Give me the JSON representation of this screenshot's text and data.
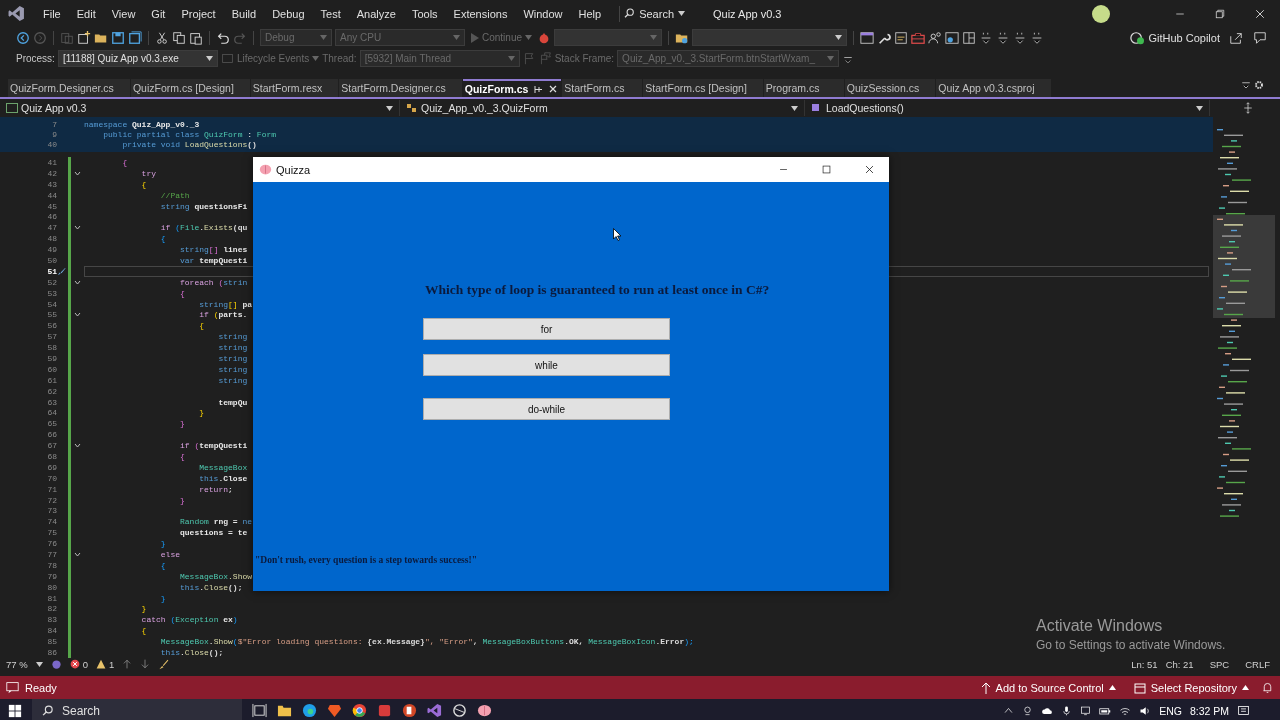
{
  "menu": [
    "File",
    "Edit",
    "View",
    "Git",
    "Project",
    "Build",
    "Debug",
    "Test",
    "Analyze",
    "Tools",
    "Extensions",
    "Window",
    "Help"
  ],
  "search": {
    "label": "Search"
  },
  "window": {
    "title": "Quiz App v0.3"
  },
  "toolbar": {
    "configuration": {
      "value": "Debug",
      "disabled": true
    },
    "platform": {
      "value": "Any CPU",
      "disabled": true
    },
    "continue": {
      "label": "Continue",
      "disabled": true
    },
    "copilot": "GitHub Copilot"
  },
  "debug_bar": {
    "process_label": "Process:",
    "process": {
      "value": "[11188] Quiz App v0.3.exe",
      "disabled": false
    },
    "lifecycle": "Lifecycle Events",
    "thread_label": "Thread:",
    "thread": {
      "value": "[5932] Main Thread",
      "disabled": true
    },
    "frame_label": "Stack Frame:",
    "frame": {
      "value": "Quiz_App_v0._3.StartForm.btnStartWxam_",
      "disabled": true
    }
  },
  "tabs": [
    {
      "label": "QuizForm.Designer.cs",
      "selected": false
    },
    {
      "label": "QuizForm.cs [Design]",
      "selected": false
    },
    {
      "label": "StartForm.resx",
      "selected": false
    },
    {
      "label": "StartForm.Designer.cs",
      "selected": false
    },
    {
      "label": "QuizForm.cs",
      "selected": true
    },
    {
      "label": "StartForm.cs",
      "selected": false
    },
    {
      "label": "StartForm.cs [Design]",
      "selected": false
    },
    {
      "label": "Program.cs",
      "selected": false
    },
    {
      "label": "QuizSession.cs",
      "selected": false
    },
    {
      "label": "Quiz App v0.3.csproj",
      "selected": false
    }
  ],
  "navigation": {
    "project": "Quiz App v0.3",
    "type": "Quiz_App_v0._3.QuizForm",
    "member": "LoadQuestions()"
  },
  "sticky_lines": [
    {
      "no": "7",
      "code": [
        {
          "t": "namespace ",
          "kind": "keyword"
        },
        {
          "t": "Quiz_App_v0._3",
          "kind": "identifier"
        }
      ]
    },
    {
      "no": "9",
      "code": [
        {
          "t": "    public partial class ",
          "kind": "keyword"
        },
        {
          "t": "QuizForm",
          "kind": "type"
        },
        {
          "t": " : ",
          "kind": "plain"
        },
        {
          "t": "Form",
          "kind": "type"
        }
      ]
    },
    {
      "no": "40",
      "code": [
        {
          "t": "        private void ",
          "kind": "keyword"
        },
        {
          "t": "LoadQuestions",
          "kind": "method"
        },
        {
          "t": "()",
          "kind": "plain"
        }
      ]
    }
  ],
  "lines": [
    {
      "no": "41",
      "fold": false,
      "current": false,
      "code": [
        {
          "t": "        {",
          "kind": "brace1"
        }
      ]
    },
    {
      "no": "42",
      "fold": true,
      "current": false,
      "code": [
        {
          "t": "            try",
          "kind": "control"
        }
      ]
    },
    {
      "no": "43",
      "fold": false,
      "current": false,
      "code": [
        {
          "t": "            {",
          "kind": "brace2"
        }
      ]
    },
    {
      "no": "44",
      "fold": false,
      "current": false,
      "code": [
        {
          "t": "                //Path",
          "kind": "comment"
        }
      ]
    },
    {
      "no": "45",
      "fold": false,
      "current": false,
      "code": [
        {
          "t": "                string ",
          "kind": "keyword"
        },
        {
          "t": "questionsFi",
          "kind": "identifier"
        }
      ]
    },
    {
      "no": "46",
      "fold": false,
      "current": false
    },
    {
      "no": "47",
      "fold": true,
      "current": false,
      "code": [
        {
          "t": "                if ",
          "kind": "control"
        },
        {
          "t": "(",
          "kind": "brace3"
        },
        {
          "t": "File",
          "kind": "type"
        },
        {
          "t": ".",
          "kind": "plain"
        },
        {
          "t": "Exists",
          "kind": "method"
        },
        {
          "t": "(qu",
          "kind": "plain"
        }
      ]
    },
    {
      "no": "48",
      "fold": false,
      "current": false,
      "code": [
        {
          "t": "                {",
          "kind": "brace3"
        }
      ]
    },
    {
      "no": "49",
      "fold": false,
      "current": false,
      "code": [
        {
          "t": "                    string",
          "kind": "keyword"
        },
        {
          "t": "[] ",
          "kind": "brace1"
        },
        {
          "t": "lines",
          "kind": "identifier"
        }
      ]
    },
    {
      "no": "50",
      "fold": false,
      "current": false,
      "code": [
        {
          "t": "                    var ",
          "kind": "keyword"
        },
        {
          "t": "tempQuesti",
          "kind": "identifier"
        }
      ]
    },
    {
      "no": "51",
      "fold": false,
      "current": true
    },
    {
      "no": "52",
      "fold": true,
      "current": false,
      "code": [
        {
          "t": "                    foreach ",
          "kind": "control"
        },
        {
          "t": "(",
          "kind": "brace1"
        },
        {
          "t": "strin",
          "kind": "keyword"
        }
      ]
    },
    {
      "no": "53",
      "fold": false,
      "current": false,
      "code": [
        {
          "t": "                    {",
          "kind": "brace1"
        }
      ]
    },
    {
      "no": "54",
      "fold": false,
      "current": false,
      "code": [
        {
          "t": "                        string",
          "kind": "keyword"
        },
        {
          "t": "[] ",
          "kind": "brace2"
        },
        {
          "t": "pa",
          "kind": "identifier"
        }
      ]
    },
    {
      "no": "55",
      "fold": true,
      "current": false,
      "code": [
        {
          "t": "                        if ",
          "kind": "control"
        },
        {
          "t": "(",
          "kind": "brace2"
        },
        {
          "t": "parts.",
          "kind": "identifier"
        }
      ]
    },
    {
      "no": "56",
      "fold": false,
      "current": false,
      "code": [
        {
          "t": "                        {",
          "kind": "brace2"
        }
      ]
    },
    {
      "no": "57",
      "fold": false,
      "current": false,
      "code": [
        {
          "t": "                            string",
          "kind": "keyword"
        }
      ]
    },
    {
      "no": "58",
      "fold": false,
      "current": false,
      "code": [
        {
          "t": "                            string",
          "kind": "keyword"
        }
      ]
    },
    {
      "no": "59",
      "fold": false,
      "current": false,
      "code": [
        {
          "t": "                            string",
          "kind": "keyword"
        }
      ]
    },
    {
      "no": "60",
      "fold": false,
      "current": false,
      "code": [
        {
          "t": "                            string",
          "kind": "keyword"
        }
      ]
    },
    {
      "no": "61",
      "fold": false,
      "current": false,
      "code": [
        {
          "t": "                            string",
          "kind": "keyword"
        }
      ]
    },
    {
      "no": "62",
      "fold": false,
      "current": false
    },
    {
      "no": "63",
      "fold": false,
      "current": false,
      "code": [
        {
          "t": "                            tempQu",
          "kind": "identifier"
        }
      ]
    },
    {
      "no": "64",
      "fold": false,
      "current": false,
      "code": [
        {
          "t": "                        }",
          "kind": "brace2"
        }
      ]
    },
    {
      "no": "65",
      "fold": false,
      "current": false,
      "code": [
        {
          "t": "                    }",
          "kind": "brace1"
        }
      ]
    },
    {
      "no": "66",
      "fold": false,
      "current": false
    },
    {
      "no": "67",
      "fold": true,
      "current": false,
      "code": [
        {
          "t": "                    if ",
          "kind": "control"
        },
        {
          "t": "(",
          "kind": "brace1"
        },
        {
          "t": "tempQuesti",
          "kind": "identifier"
        }
      ]
    },
    {
      "no": "68",
      "fold": false,
      "current": false,
      "code": [
        {
          "t": "                    {",
          "kind": "brace1"
        }
      ]
    },
    {
      "no": "69",
      "fold": false,
      "current": false,
      "code": [
        {
          "t": "                        MessageBox",
          "kind": "type"
        }
      ]
    },
    {
      "no": "70",
      "fold": false,
      "current": false,
      "code": [
        {
          "t": "                        this",
          "kind": "keyword"
        },
        {
          "t": ".Close",
          "kind": "identifier"
        }
      ]
    },
    {
      "no": "71",
      "fold": false,
      "current": false,
      "code": [
        {
          "t": "                        return",
          "kind": "control"
        },
        {
          "t": ";",
          "kind": "plain"
        }
      ]
    },
    {
      "no": "72",
      "fold": false,
      "current": false,
      "code": [
        {
          "t": "                    }",
          "kind": "brace1"
        }
      ]
    },
    {
      "no": "73",
      "fold": false,
      "current": false
    },
    {
      "no": "74",
      "fold": false,
      "current": false,
      "code": [
        {
          "t": "                    Random ",
          "kind": "type"
        },
        {
          "t": "rng = ",
          "kind": "identifier"
        },
        {
          "t": "ne",
          "kind": "keyword"
        }
      ]
    },
    {
      "no": "75",
      "fold": false,
      "current": false,
      "code": [
        {
          "t": "                    questions = te",
          "kind": "identifier"
        }
      ]
    },
    {
      "no": "76",
      "fold": false,
      "current": false,
      "code": [
        {
          "t": "                }",
          "kind": "brace3"
        }
      ]
    },
    {
      "no": "77",
      "fold": true,
      "current": false,
      "code": [
        {
          "t": "                else",
          "kind": "control"
        }
      ]
    },
    {
      "no": "78",
      "fold": false,
      "current": false,
      "code": [
        {
          "t": "                {",
          "kind": "brace3"
        }
      ]
    },
    {
      "no": "79",
      "fold": false,
      "current": false,
      "code": [
        {
          "t": "                    MessageBox",
          "kind": "type"
        },
        {
          "t": ".Show",
          "kind": "method"
        }
      ]
    },
    {
      "no": "80",
      "fold": false,
      "current": false,
      "code": [
        {
          "t": "                    this",
          "kind": "keyword"
        },
        {
          "t": ".",
          "kind": "plain"
        },
        {
          "t": "Close",
          "kind": "method"
        },
        {
          "t": "();",
          "kind": "plain"
        }
      ]
    },
    {
      "no": "81",
      "fold": false,
      "current": false,
      "code": [
        {
          "t": "                }",
          "kind": "brace3"
        }
      ]
    },
    {
      "no": "82",
      "fold": false,
      "current": false,
      "code": [
        {
          "t": "            }",
          "kind": "brace2"
        }
      ]
    },
    {
      "no": "83",
      "fold": false,
      "current": false,
      "code": [
        {
          "t": "            catch ",
          "kind": "control"
        },
        {
          "t": "(",
          "kind": "brace3"
        },
        {
          "t": "Exception ",
          "kind": "type"
        },
        {
          "t": "ex",
          "kind": "identifier"
        },
        {
          "t": ")",
          "kind": "brace3"
        }
      ]
    },
    {
      "no": "84",
      "fold": false,
      "current": false,
      "code": [
        {
          "t": "            {",
          "kind": "brace2"
        }
      ]
    },
    {
      "no": "85",
      "fold": false,
      "current": false,
      "code": [
        {
          "t": "                MessageBox",
          "kind": "type"
        },
        {
          "t": ".",
          "kind": "plain"
        },
        {
          "t": "Show",
          "kind": "method"
        },
        {
          "t": "(",
          "kind": "brace3"
        },
        {
          "t": "$\"Error loading questions: ",
          "kind": "string"
        },
        {
          "t": "{ex.Message}",
          "kind": "plain"
        },
        {
          "t": "\", ",
          "kind": "string"
        },
        {
          "t": "\"Error\"",
          "kind": "string"
        },
        {
          "t": ", ",
          "kind": "plain"
        },
        {
          "t": "MessageBoxButtons",
          "kind": "type"
        },
        {
          "t": ".OK, ",
          "kind": "plain"
        },
        {
          "t": "MessageBoxIcon",
          "kind": "type"
        },
        {
          "t": ".Error",
          "kind": "plain"
        },
        {
          "t": ");",
          "kind": "brace3"
        }
      ]
    },
    {
      "no": "86",
      "fold": false,
      "current": false,
      "code": [
        {
          "t": "                this",
          "kind": "keyword"
        },
        {
          "t": ".",
          "kind": "plain"
        },
        {
          "t": "Close",
          "kind": "method"
        },
        {
          "t": "();",
          "kind": "plain"
        }
      ]
    }
  ],
  "editor_status": {
    "zoom": "77 %",
    "errors": "0",
    "warnings": "1",
    "line": "Ln: 51",
    "column": "Ch: 21",
    "whitespace": "SPC",
    "line_endings": "CRLF"
  },
  "dialog": {
    "title": "Quizza",
    "question": "Which type of loop is guaranteed to run at least once in C#?",
    "options": [
      "for",
      "while",
      "do-while"
    ],
    "motto": "\"Don't rush, every question is a step towards success!\""
  },
  "activation": {
    "title": "Activate Windows",
    "hint": "Go to Settings to activate Windows."
  },
  "status_bar": {
    "state": "Ready",
    "source_control": "Add to Source Control",
    "repository": "Select Repository"
  },
  "taskbar": {
    "search": "Search",
    "language": "ENG",
    "time": "8:32 PM"
  }
}
